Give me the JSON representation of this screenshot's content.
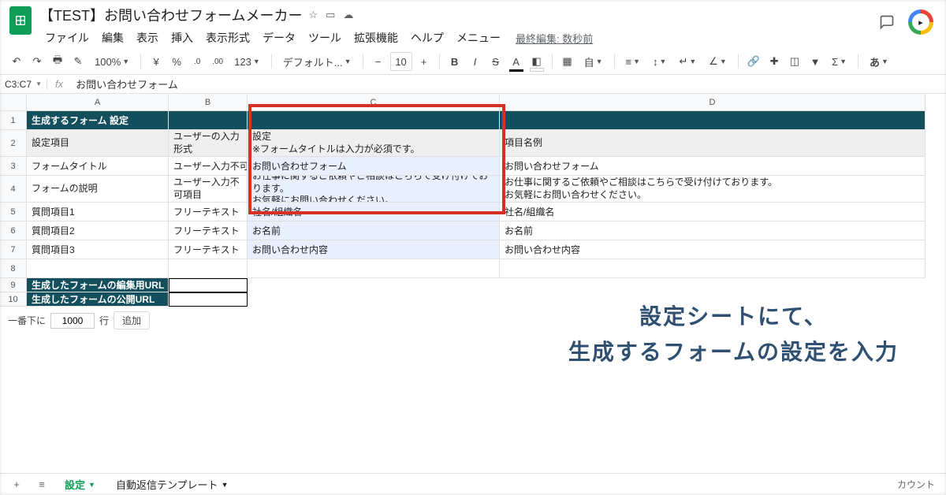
{
  "doc_title": "【TEST】お問い合わせフォームメーカー",
  "menus": [
    "ファイル",
    "編集",
    "表示",
    "挿入",
    "表示形式",
    "データ",
    "ツール",
    "拡張機能",
    "ヘルプ",
    "メニュー"
  ],
  "last_edit": "最終編集: 数秒前",
  "toolbar": {
    "zoom": "100%",
    "currency": "¥",
    "pct": "%",
    "dec_dec": ".0",
    "dec_inc": ".00",
    "numfmt": "123",
    "font": "デフォルト...",
    "size": "10"
  },
  "name_box": "C3:C7",
  "fx_label": "fx",
  "formula_value": "お問い合わせフォーム",
  "col_labels": [
    "A",
    "B",
    "C",
    "D"
  ],
  "row_labels": [
    "1",
    "2",
    "3",
    "4",
    "5",
    "6",
    "7",
    "8",
    "9",
    "10"
  ],
  "rows": {
    "r1": {
      "a": "生成するフォーム 設定"
    },
    "r2": {
      "a": "設定項目",
      "b": "ユーザーの入力形式",
      "c": "設定\n※フォームタイトルは入力が必須です。",
      "d": "項目名例"
    },
    "r3": {
      "a": "フォームタイトル",
      "b": "ユーザー入力不可項目",
      "c": "お問い合わせフォーム",
      "d": "お問い合わせフォーム"
    },
    "r4": {
      "a": "フォームの説明",
      "b": "ユーザー入力不可項目",
      "c": "お仕事に関するご依頼やご相談はこちらで受け付けております。\nお気軽にお問い合わせください。",
      "d": "お仕事に関するご依頼やご相談はこちらで受け付けております。\nお気軽にお問い合わせください。"
    },
    "r5": {
      "a": "質問項目1",
      "b": "フリーテキスト",
      "c": "社名/組織名",
      "d": "社名/組織名"
    },
    "r6": {
      "a": "質問項目2",
      "b": "フリーテキスト",
      "c": "お名前",
      "d": "お名前"
    },
    "r7": {
      "a": "質問項目3",
      "b": "フリーテキスト",
      "c": "お問い合わせ内容",
      "d": "お問い合わせ内容"
    },
    "r9": {
      "a": "生成したフォームの編集用URL"
    },
    "r10": {
      "a": "生成したフォームの公開URL"
    }
  },
  "jump": {
    "label_pre": "一番下に",
    "value": "1000",
    "label_post": "行",
    "btn": "追加"
  },
  "annotation_line1": "設定シートにて、",
  "annotation_line2": "生成するフォームの設定を入力",
  "footer": {
    "tab_active": "設定",
    "tab2": "自動返信テンプレート",
    "count": "カウント"
  }
}
